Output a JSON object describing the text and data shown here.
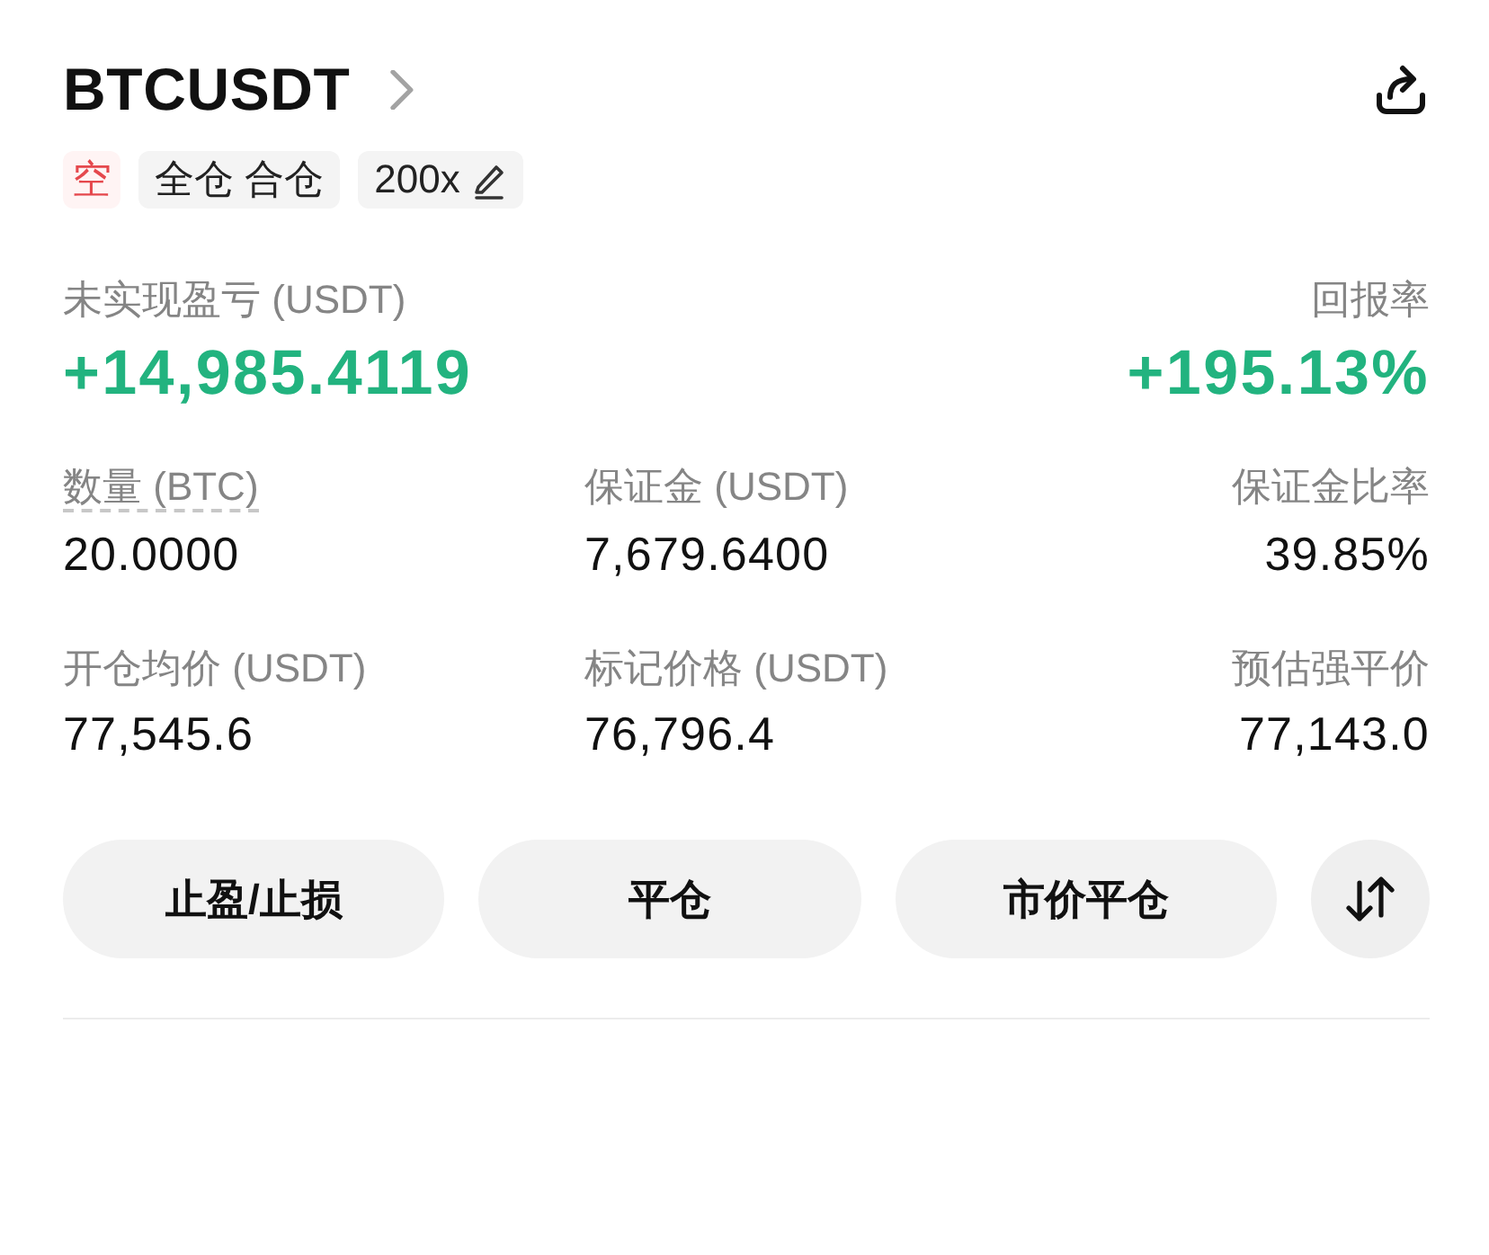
{
  "header": {
    "title": "BTCUSDT"
  },
  "tags": [
    {
      "kind": "side",
      "text": "空",
      "editable": false
    },
    {
      "kind": "mode",
      "text": "全仓 合仓",
      "editable": false
    },
    {
      "kind": "leverage",
      "text": "200x",
      "editable": true
    }
  ],
  "summary": [
    {
      "label": "未实现盈亏 (USDT)",
      "value": "+14,985.4119",
      "positive": true
    },
    {
      "label": "回报率",
      "value": "+195.13%",
      "positive": true
    }
  ],
  "stats": [
    {
      "label": "数量 (BTC)",
      "value": "20.0000",
      "has_tooltip": true
    },
    {
      "label": "保证金 (USDT)",
      "value": "7,679.6400",
      "has_tooltip": false
    },
    {
      "label": "保证金比率",
      "value": "39.85%",
      "has_tooltip": false
    },
    {
      "label": "开仓均价 (USDT)",
      "value": "77,545.6",
      "has_tooltip": false
    },
    {
      "label": "标记价格 (USDT)",
      "value": "76,796.4",
      "has_tooltip": false
    },
    {
      "label": "预估强平价",
      "value": "77,143.0",
      "has_tooltip": false
    }
  ],
  "actions": [
    {
      "kind": "text",
      "label": "止盈/止损"
    },
    {
      "kind": "text",
      "label": "平仓"
    },
    {
      "kind": "text",
      "label": "市价平仓"
    },
    {
      "kind": "icon"
    }
  ]
}
